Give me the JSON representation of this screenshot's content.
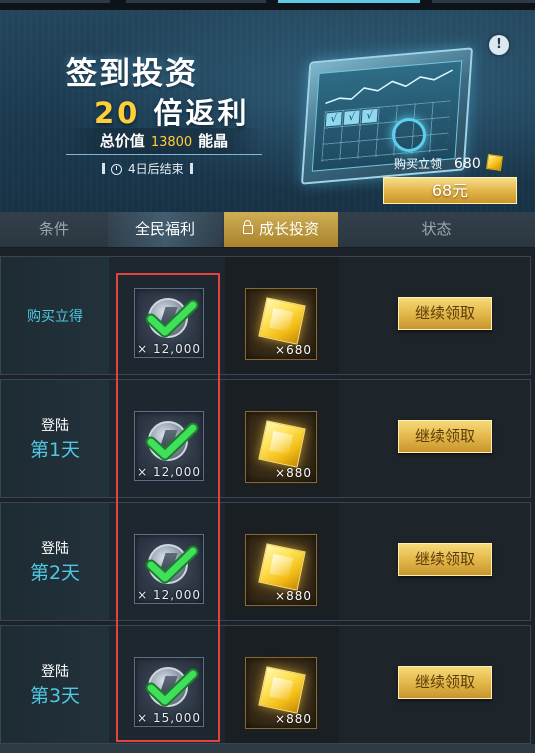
{
  "banner": {
    "title_line1": "签到投资",
    "title_line2_num": "20",
    "title_line2_text": "倍返利",
    "total_label": "总价值",
    "total_amount": "13800",
    "total_unit": "能晶",
    "countdown": "4日后结束",
    "info_symbol": "!",
    "buy_label": "购买立领",
    "buy_amount": "680",
    "price_button": "68元"
  },
  "tabs": {
    "condition": "条件",
    "welfare": "全民福利",
    "growth": "成长投资",
    "status": "状态"
  },
  "rows": [
    {
      "cond_single": "购买立得",
      "cond_small": "",
      "cond_big": "",
      "welfare_qty": "× 12,000",
      "welfare_claimed": true,
      "growth_qty": "×680",
      "button": "继续领取"
    },
    {
      "cond_single": "",
      "cond_small": "登陆",
      "cond_big": "第1天",
      "welfare_qty": "× 12,000",
      "welfare_claimed": true,
      "growth_qty": "×880",
      "button": "继续领取"
    },
    {
      "cond_single": "",
      "cond_small": "登陆",
      "cond_big": "第2天",
      "welfare_qty": "× 12,000",
      "welfare_claimed": true,
      "growth_qty": "×880",
      "button": "继续领取"
    },
    {
      "cond_single": "",
      "cond_small": "登陆",
      "cond_big": "第3天",
      "welfare_qty": "× 15,000",
      "welfare_claimed": true,
      "growth_qty": "×880",
      "button": "继续领取"
    }
  ],
  "colors": {
    "accent_cyan": "#4fc8e4",
    "gold": "#ffcf3a",
    "highlight_outline": "#e2433e"
  }
}
